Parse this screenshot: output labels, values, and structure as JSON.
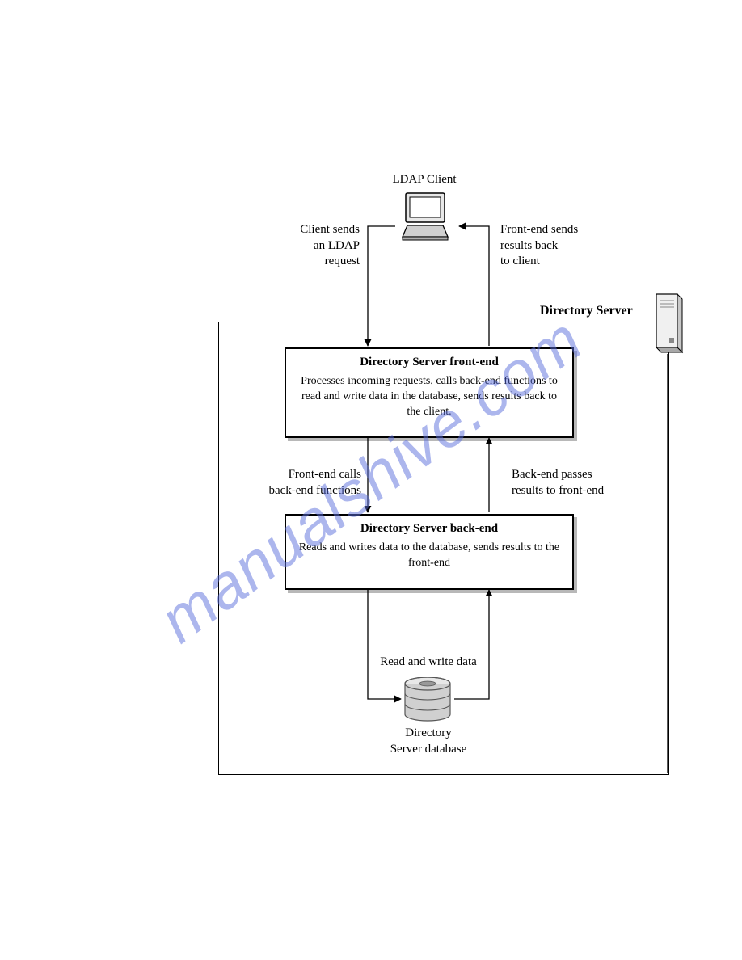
{
  "top_label": "LDAP Client",
  "left_req": {
    "l1": "Client sends",
    "l2": "an LDAP",
    "l3": "request"
  },
  "right_resp": {
    "l1": "Front-end sends",
    "l2": "results back",
    "l3": "to client"
  },
  "ds_title": "Directory Server",
  "frontend": {
    "title": "Directory Server front-end",
    "body": "Processes incoming requests, calls back-end functions to read and write data in the database, sends results back to the client."
  },
  "mid_left": {
    "l1": "Front-end calls",
    "l2": "back-end functions"
  },
  "mid_right": {
    "l1": "Back-end passes",
    "l2": "results to front-end"
  },
  "backend": {
    "title": "Directory Server back-end",
    "body": "Reads and writes data to the database, sends results to the front-end"
  },
  "rw_label": "Read and write data",
  "db_label": {
    "l1": "Directory",
    "l2": "Server database"
  },
  "watermark": "manualshive.com"
}
